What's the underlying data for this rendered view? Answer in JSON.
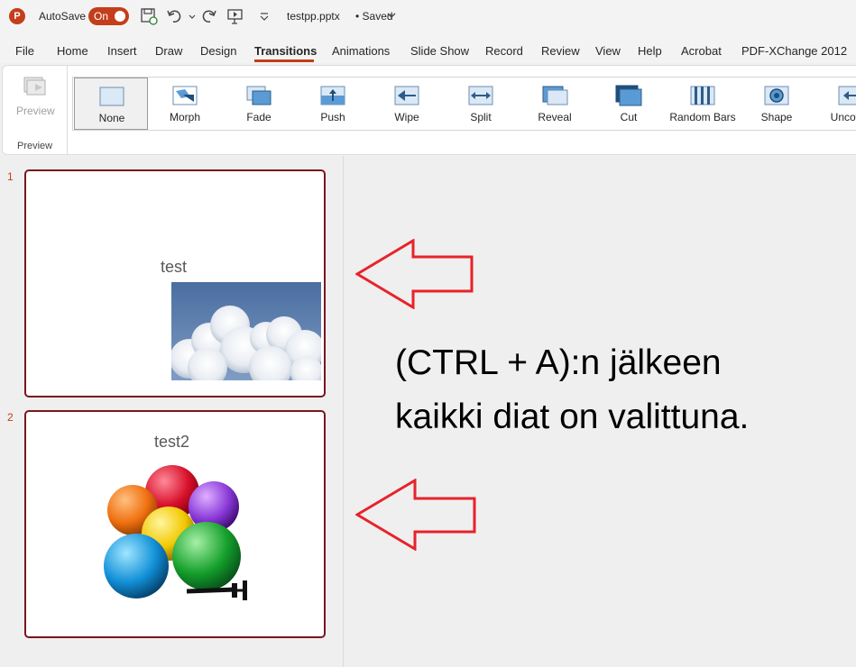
{
  "titlebar": {
    "app_logo": "P",
    "autosave_label": "AutoSave",
    "autosave_toggle": "On",
    "doc_title": "testpp.pptx",
    "doc_status": "• Saved"
  },
  "menu": {
    "tabs": [
      {
        "label": "File"
      },
      {
        "label": "Home"
      },
      {
        "label": "Insert"
      },
      {
        "label": "Draw"
      },
      {
        "label": "Design"
      },
      {
        "label": "Transitions",
        "active": true
      },
      {
        "label": "Animations"
      },
      {
        "label": "Slide Show"
      },
      {
        "label": "Record"
      },
      {
        "label": "Review"
      },
      {
        "label": "View"
      },
      {
        "label": "Help"
      },
      {
        "label": "Acrobat"
      },
      {
        "label": "PDF-XChange 2012"
      }
    ]
  },
  "ribbon": {
    "preview_button": "Preview",
    "preview_group_label": "Preview",
    "gallery": [
      {
        "label": "None",
        "icon": "none-transition-icon",
        "selected": true
      },
      {
        "label": "Morph",
        "icon": "morph-transition-icon"
      },
      {
        "label": "Fade",
        "icon": "fade-transition-icon"
      },
      {
        "label": "Push",
        "icon": "push-transition-icon"
      },
      {
        "label": "Wipe",
        "icon": "wipe-transition-icon"
      },
      {
        "label": "Split",
        "icon": "split-transition-icon"
      },
      {
        "label": "Reveal",
        "icon": "reveal-transition-icon"
      },
      {
        "label": "Cut",
        "icon": "cut-transition-icon"
      },
      {
        "label": "Random Bars",
        "icon": "random-bars-transition-icon"
      },
      {
        "label": "Shape",
        "icon": "shape-transition-icon"
      },
      {
        "label": "Uncover",
        "icon": "uncover-transition-icon"
      }
    ]
  },
  "slides": [
    {
      "number": "1",
      "title": "test",
      "image": "clouds-image"
    },
    {
      "number": "2",
      "title": "test2",
      "image": "colorful-balls-image"
    }
  ],
  "canvas": {
    "caption_line1": "(CTRL + A):n jälkeen",
    "caption_line2": "kaikki diat on valittuna."
  },
  "colors": {
    "accent": "#c43e1c",
    "slide_border": "#7a1520",
    "arrow": "#e8222a"
  }
}
